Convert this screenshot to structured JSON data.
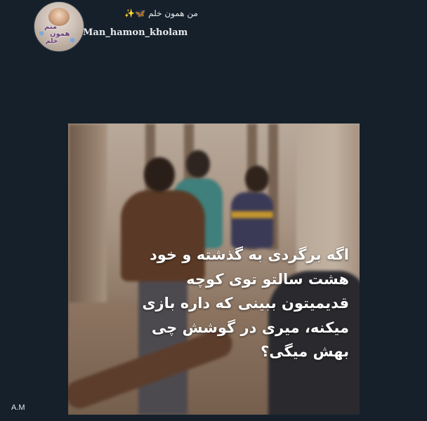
{
  "tweet": {
    "display_name": "من همون خلم",
    "display_name_emojis": "🦋✨",
    "username": "Man_hamon_kholam",
    "avatar_text": [
      "منم",
      "همون",
      "خلم"
    ]
  },
  "image": {
    "caption_lines": [
      "اگه برگردی به گذشته و خود",
      "هشت سالتو توی کوچه",
      "قدیمیتون ببینی که داره بازی",
      "میکنه، میری در گوشش چی",
      "بهش میگی؟"
    ]
  },
  "signature": "A.M",
  "colors": {
    "background": "#15202b",
    "text": "#e7e9ea"
  }
}
